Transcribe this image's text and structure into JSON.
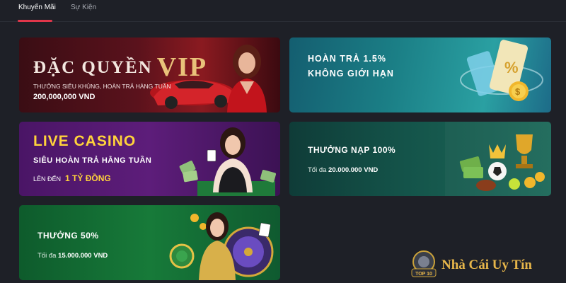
{
  "tabs": [
    {
      "label": "Khuyến Mãi",
      "active": true
    },
    {
      "label": "Sự Kiện",
      "active": false
    }
  ],
  "promos": {
    "vip": {
      "title_prefix": "ĐẶC QUYỀN",
      "title_vip": "VIP",
      "subtitle": "THƯỞNG SIÊU KHỦNG, HOÀN TRẢ HÀNG TUẦN",
      "amount": "200,000,000 VND"
    },
    "cashback": {
      "line1": "HOÀN TRẢ 1.5%",
      "line2": "KHÔNG GIỚI HẠN"
    },
    "casino": {
      "title": "LIVE CASINO",
      "subtitle": "SIÊU HOÀN TRẢ HẰNG TUẦN",
      "upto_label": "LÊN ĐẾN",
      "upto_value": "1 TỶ ĐỒNG"
    },
    "deposit": {
      "title": "THƯỞNG NẠP 100%",
      "max_label": "Tối đa",
      "max_value": "20.000.000 VND"
    },
    "fifty": {
      "title": "THƯỞNG 50%",
      "max_label": "Tối đa",
      "max_value": "15.000.000 VND"
    }
  },
  "watermark": {
    "text": "Nhà Cái Uy Tín",
    "logo_text": "TOP 10"
  },
  "colors": {
    "background": "#1e2027",
    "tab_accent": "#e0364a",
    "gold": "#ffd33b"
  }
}
